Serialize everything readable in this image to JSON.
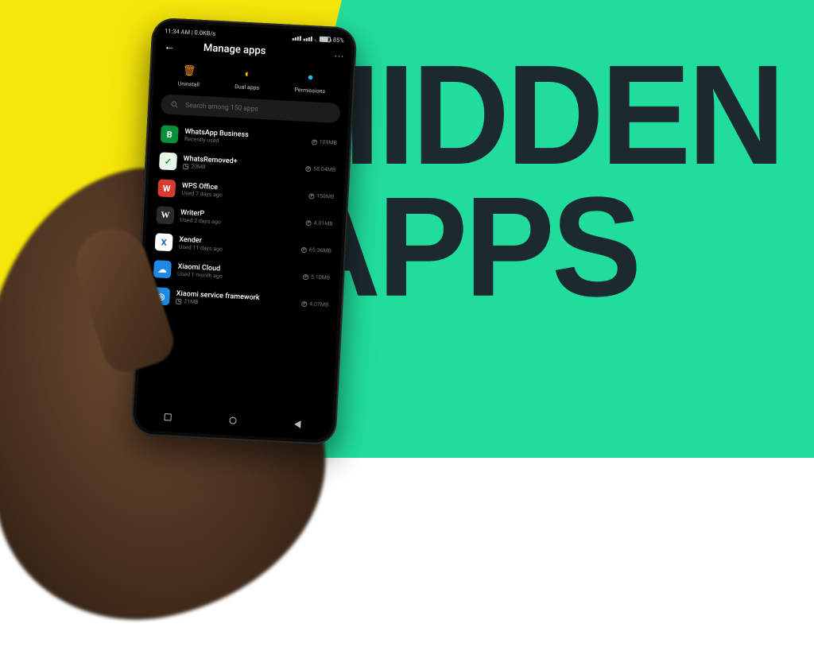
{
  "background": {
    "left_color": "#f6e60a",
    "right_color": "#21dd9d"
  },
  "headline": {
    "line1": "HIDDEN",
    "line2": "APPS"
  },
  "statusbar": {
    "time": "11:34 AM",
    "speed": "0.0KB/s",
    "battery": "85%"
  },
  "header": {
    "title": "Manage apps"
  },
  "actions": {
    "uninstall": "Uninstall",
    "dual": "Dual apps",
    "permissions": "Permissions"
  },
  "search": {
    "placeholder": "Search among 150 apps"
  },
  "apps": [
    {
      "name": "WhatsApp Business",
      "sub": "Recently used",
      "size": "109MB",
      "icon_bg": "#0a8f3c",
      "icon_txt": "B"
    },
    {
      "name": "WhatsRemoved+",
      "sub": "20MB",
      "size": "58.04MB",
      "icon_bg": "#e8f5e9",
      "icon_txt": "✓",
      "icon_fg": "#0a8f3c",
      "sub_is_storage": true
    },
    {
      "name": "WPS Office",
      "sub": "Used 7 days ago",
      "size": "158MB",
      "icon_bg": "#d73a2f",
      "icon_txt": "W"
    },
    {
      "name": "WriterP",
      "sub": "Used 2 days ago",
      "size": "4.01MB",
      "icon_bg": "#2b2b2b",
      "icon_txt": "W",
      "serif": true
    },
    {
      "name": "Xender",
      "sub": "Used 11 days ago",
      "size": "65.36MB",
      "icon_bg": "#ffffff",
      "icon_txt": "X",
      "icon_fg": "#1565c0"
    },
    {
      "name": "Xiaomi Cloud",
      "sub": "Used 1 month ago",
      "size": "5.10MB",
      "icon_bg": "#1e88e5",
      "icon_txt": "☁"
    },
    {
      "name": "Xiaomi service framework",
      "sub": "21MB",
      "size": "4.07MB",
      "icon_bg": "#1e88e5",
      "icon_txt": "◎",
      "sub_is_storage": true
    }
  ]
}
